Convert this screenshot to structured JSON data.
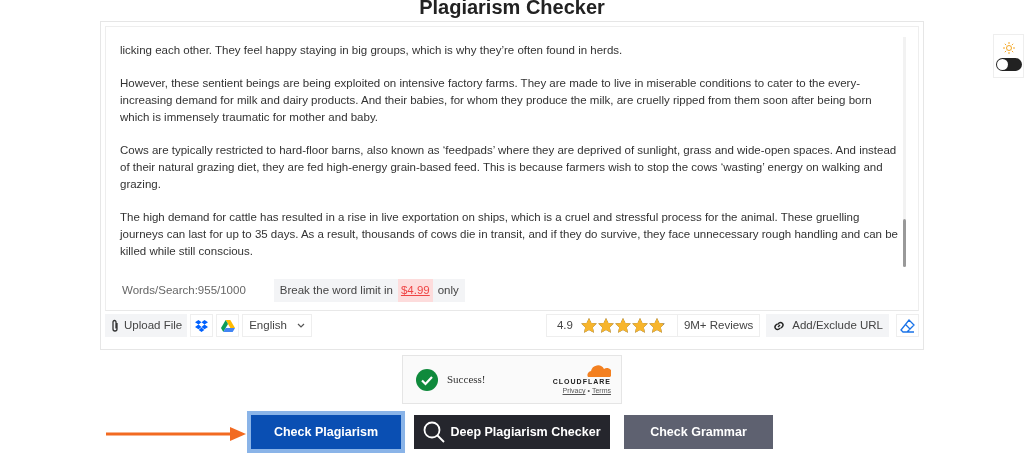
{
  "title": "Plagiarism Checker",
  "paragraphs": [
    "licking each other. They feel happy staying in big groups, which is why they’re often found in herds.",
    "However, these sentient beings are being exploited on intensive factory farms. They are made to live in miserable conditions to cater to the every-increasing demand for milk and dairy products. And their babies, for whom they produce the milk, are cruelly ripped from them soon after being born which is immensely traumatic for mother and baby.",
    "Cows are typically restricted to hard-floor barns, also known as ‘feedpads’ where they are deprived of sunlight, grass and wide-open spaces.  And instead of their natural grazing diet, they are fed high-energy grain-based feed. This is because farmers wish to stop the cows ‘wasting’ energy on walking and grazing.",
    "The high demand for cattle has resulted in a rise in live exportation on ships, which is a cruel and stressful process for the animal. These gruelling journeys can last for up to 35 days. As a result, thousands of cows die in transit, and if they do survive, they face unnecessary rough handling and can be killed while still conscious."
  ],
  "word_count": "Words/Search:955/1000",
  "upgrade": {
    "before": "Break the word limit in",
    "price": "$4.99",
    "after": "only"
  },
  "upload": "Upload File",
  "language": "English",
  "rating": {
    "score": "4.9",
    "stars": 4.9,
    "reviews": "9M+ Reviews"
  },
  "exclude_url": "Add/Exclude URL",
  "captcha": {
    "status": "Success!",
    "brand": "CLOUDFLARE",
    "privacy": "Privacy",
    "separator": "•",
    "terms": "Terms"
  },
  "buttons": [
    {
      "label": "Check Plagiarism",
      "kind": "primary",
      "focused": true
    },
    {
      "label": "Deep Plagiarism Checker",
      "kind": "deep",
      "focused": false
    },
    {
      "label": "Check Grammar",
      "kind": "grammar",
      "focused": false
    }
  ],
  "dark_mode": {
    "on": false
  }
}
